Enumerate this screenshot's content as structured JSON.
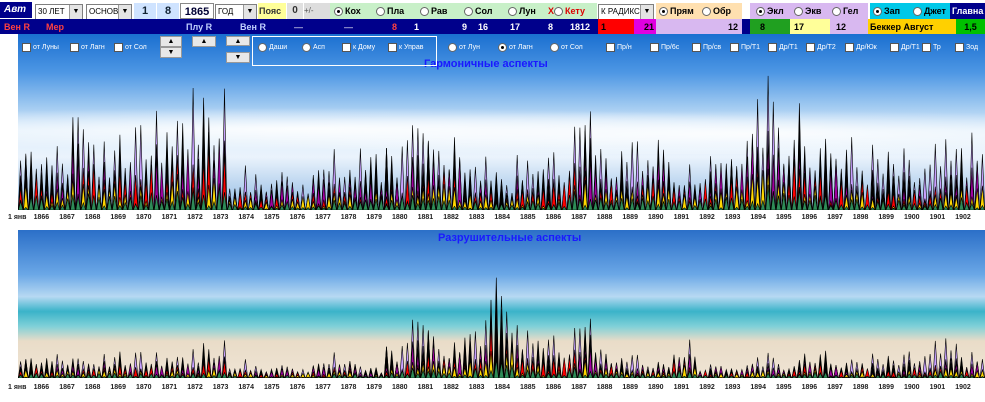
{
  "toolbar": {
    "avt": "Авт",
    "period": "30 ЛЕТ",
    "mode": "ОСНОВ",
    "day": "1",
    "month": "8",
    "year": "1865",
    "unit": "ГОД",
    "belt_label": "Пояс",
    "belt_value": "0",
    "plus_minus": "+/-",
    "planets_top": [
      "Кох",
      "Пла",
      "Рав",
      "Сол",
      "Лун"
    ],
    "ketu": "Кету",
    "to_radix": "К РАДИКС",
    "direct": "Прям",
    "reverse": "Обр",
    "ecl": "Экл",
    "equ": "Экв",
    "hel": "Гел",
    "west": "Зап",
    "jyot": "Джет",
    "main": "Главна"
  },
  "toolbar_row2": {
    "ven_r": "Вен R",
    "mer": "Мер",
    "plu_r": "Плу R",
    "ven_r2": "Вен R",
    "dash1": "—",
    "dash2": "—",
    "dash3": "—",
    "n1": "8",
    "n2": "1",
    "n3": "9",
    "n4": "16",
    "n5": "17",
    "n6": "8",
    "n7": "1812",
    "n8": "1",
    "n9": "21",
    "n10": "12",
    "n11": "8",
    "n12": "17",
    "n13": "12",
    "becker": "Беккер Август",
    "n14": "1,5"
  },
  "options": {
    "from_moon": "от Луны",
    "from_lagn": "от Лагн",
    "from_sol": "от Сол",
    "dashi": "Даши",
    "asp": "Асп",
    "k_domu": "к Дому",
    "k_uprav": "к Управ",
    "ot_lun": "от Лун",
    "ot_lagn": "от Лагн",
    "ot_sol": "от Сол",
    "checks": [
      "Пр/н",
      "Пр/6с",
      "Пр/св",
      "Пр/Т1",
      "Др/Т1",
      "Др/Т2",
      "Др/Юк",
      "Др/Т1",
      "Тр",
      "Зод"
    ]
  },
  "chart_top": {
    "title": "Гармоничные аспекты",
    "axis_labels": [
      "1 янв",
      "1866",
      "1867",
      "1868",
      "1869",
      "1870",
      "1871",
      "1872",
      "1873",
      "1874",
      "1875",
      "1876",
      "1877",
      "1878",
      "1879",
      "1880",
      "1881",
      "1882",
      "1883",
      "1884",
      "1885",
      "1886",
      "1887",
      "1888",
      "1889",
      "1890",
      "1891",
      "1892",
      "1893",
      "1894",
      "1895",
      "1896",
      "1897",
      "1898",
      "1899",
      "1900",
      "1901",
      "1902"
    ]
  },
  "chart_bottom": {
    "title": "Разрушительные аспекты",
    "axis_labels": [
      "1 янв",
      "1866",
      "1867",
      "1868",
      "1869",
      "1870",
      "1871",
      "1872",
      "1873",
      "1874",
      "1875",
      "1876",
      "1877",
      "1878",
      "1879",
      "1880",
      "1881",
      "1882",
      "1883",
      "1884",
      "1885",
      "1886",
      "1887",
      "1888",
      "1889",
      "1890",
      "1891",
      "1892",
      "1893",
      "1894",
      "1895",
      "1896",
      "1897",
      "1898",
      "1899",
      "1900",
      "1901",
      "1902"
    ]
  },
  "chart_data": [
    {
      "type": "area",
      "title": "Гармоничные аспекты",
      "x": [
        "1866",
        "1867",
        "1868",
        "1869",
        "1870",
        "1871",
        "1872",
        "1873",
        "1874",
        "1875",
        "1876",
        "1877",
        "1878",
        "1879",
        "1880",
        "1881",
        "1882",
        "1883",
        "1884",
        "1885",
        "1886",
        "1887",
        "1888",
        "1889",
        "1890",
        "1891",
        "1892",
        "1893",
        "1894",
        "1895",
        "1896",
        "1897",
        "1898",
        "1899",
        "1900",
        "1901",
        "1902"
      ],
      "series": [
        {
          "values": [
            0.55,
            0.45,
            0.72,
            0.6,
            0.55,
            0.65,
            0.78,
            0.95,
            0.3,
            0.25,
            0.3,
            0.35,
            0.4,
            0.45,
            0.5,
            0.55,
            0.6,
            0.35,
            0.3,
            0.35,
            0.4,
            0.7,
            0.45,
            0.5,
            0.55,
            0.35,
            0.5,
            0.55,
            0.9,
            0.75,
            0.55,
            0.5,
            0.45,
            0.4,
            0.35,
            0.45,
            0.5
          ]
        }
      ],
      "colors": [
        "#000000",
        "#ff0000",
        "#ffd700",
        "#a000a0",
        "#c8a0ff",
        "#2e8b57"
      ]
    },
    {
      "type": "area",
      "title": "Разрушительные аспекты",
      "x": [
        "1866",
        "1867",
        "1868",
        "1869",
        "1870",
        "1871",
        "1872",
        "1873",
        "1874",
        "1875",
        "1876",
        "1877",
        "1878",
        "1879",
        "1880",
        "1881",
        "1882",
        "1883",
        "1884",
        "1885",
        "1886",
        "1887",
        "1888",
        "1889",
        "1890",
        "1891",
        "1892",
        "1893",
        "1894",
        "1895",
        "1896",
        "1897",
        "1898",
        "1899",
        "1900",
        "1901",
        "1902"
      ],
      "series": [
        {
          "values": [
            0.22,
            0.2,
            0.18,
            0.25,
            0.2,
            0.2,
            0.22,
            0.35,
            0.15,
            0.1,
            0.12,
            0.15,
            0.2,
            0.1,
            0.3,
            0.45,
            0.35,
            0.45,
            0.95,
            0.4,
            0.35,
            0.5,
            0.25,
            0.2,
            0.15,
            0.35,
            0.15,
            0.12,
            0.2,
            0.15,
            0.25,
            0.15,
            0.2,
            0.18,
            0.22,
            0.3,
            0.2
          ]
        }
      ],
      "colors": [
        "#000000",
        "#ff0000",
        "#ffd700",
        "#a000a0",
        "#c8a0ff",
        "#2e8b57"
      ]
    }
  ]
}
